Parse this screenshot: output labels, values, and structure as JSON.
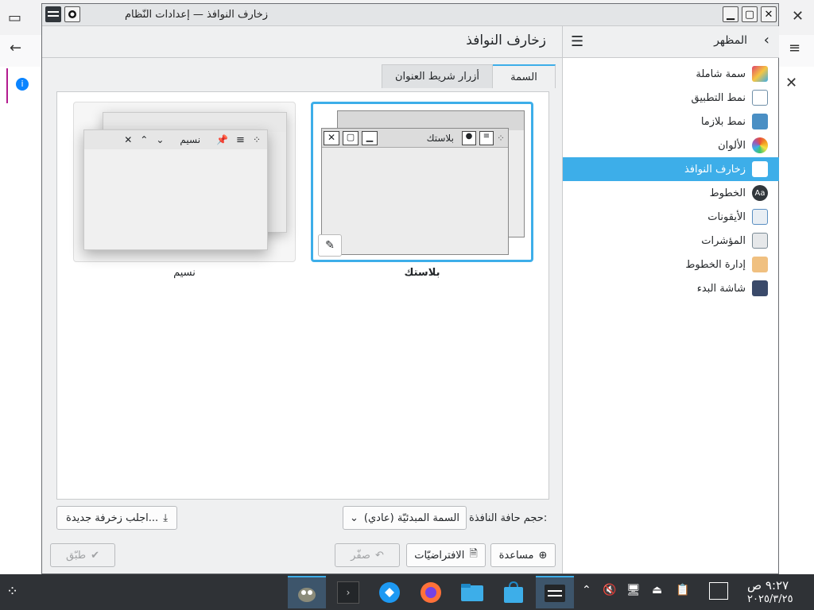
{
  "window": {
    "title": "زخارف النوافذ — إعدادات النّظام"
  },
  "sidebar": {
    "header": "المظهر",
    "items": [
      {
        "label": "سمة شاملة",
        "icon": "global-theme-icon",
        "color": "#e0446b"
      },
      {
        "label": "نمط التطبيق",
        "icon": "app-style-icon",
        "color": "#6f8fa8"
      },
      {
        "label": "نمط بلازما",
        "icon": "plasma-style-icon",
        "color": "#4a8fc4"
      },
      {
        "label": "الألوان",
        "icon": "colors-icon",
        "color": "#f39c1f"
      },
      {
        "label": "زخارف النوافذ",
        "icon": "window-decorations-icon",
        "color": "#ffffff"
      },
      {
        "label": "الخطوط",
        "icon": "fonts-icon",
        "color": "#31363b"
      },
      {
        "label": "الأيقونات",
        "icon": "icons-icon",
        "color": "#5a8fc2"
      },
      {
        "label": "المؤشرات",
        "icon": "cursors-icon",
        "color": "#7b8b95"
      },
      {
        "label": "إدارة الخطوط",
        "icon": "font-management-icon",
        "color": "#e6a050"
      },
      {
        "label": "شاشة البدء",
        "icon": "splash-screen-icon",
        "color": "#3a4a6a"
      }
    ]
  },
  "page": {
    "title": "زخارف النوافذ",
    "tabs": [
      "السمة",
      "أزرار شريط العنوان"
    ],
    "themes": [
      {
        "name": "بلاستك",
        "preview_title": "بلاستك",
        "selected": true
      },
      {
        "name": "نسيم",
        "preview_title": "نسيم",
        "selected": false
      }
    ],
    "border_size_label": "حجم حافة النافذة:",
    "border_size_value": "السمة المبدئيّة (عادي)",
    "get_new_label": "اجلب زخرفة جديدة..."
  },
  "footer": {
    "help": "مساعدة",
    "defaults": "الافتراضيّات",
    "reset": "صفّر",
    "apply": "طبّق"
  },
  "taskbar": {
    "time": "٩:٢٧ ص",
    "date": "٢٠٢٥/٣/٢٥"
  },
  "colors": {
    "accent": "#3daee9",
    "taskbar": "#2f3236"
  }
}
